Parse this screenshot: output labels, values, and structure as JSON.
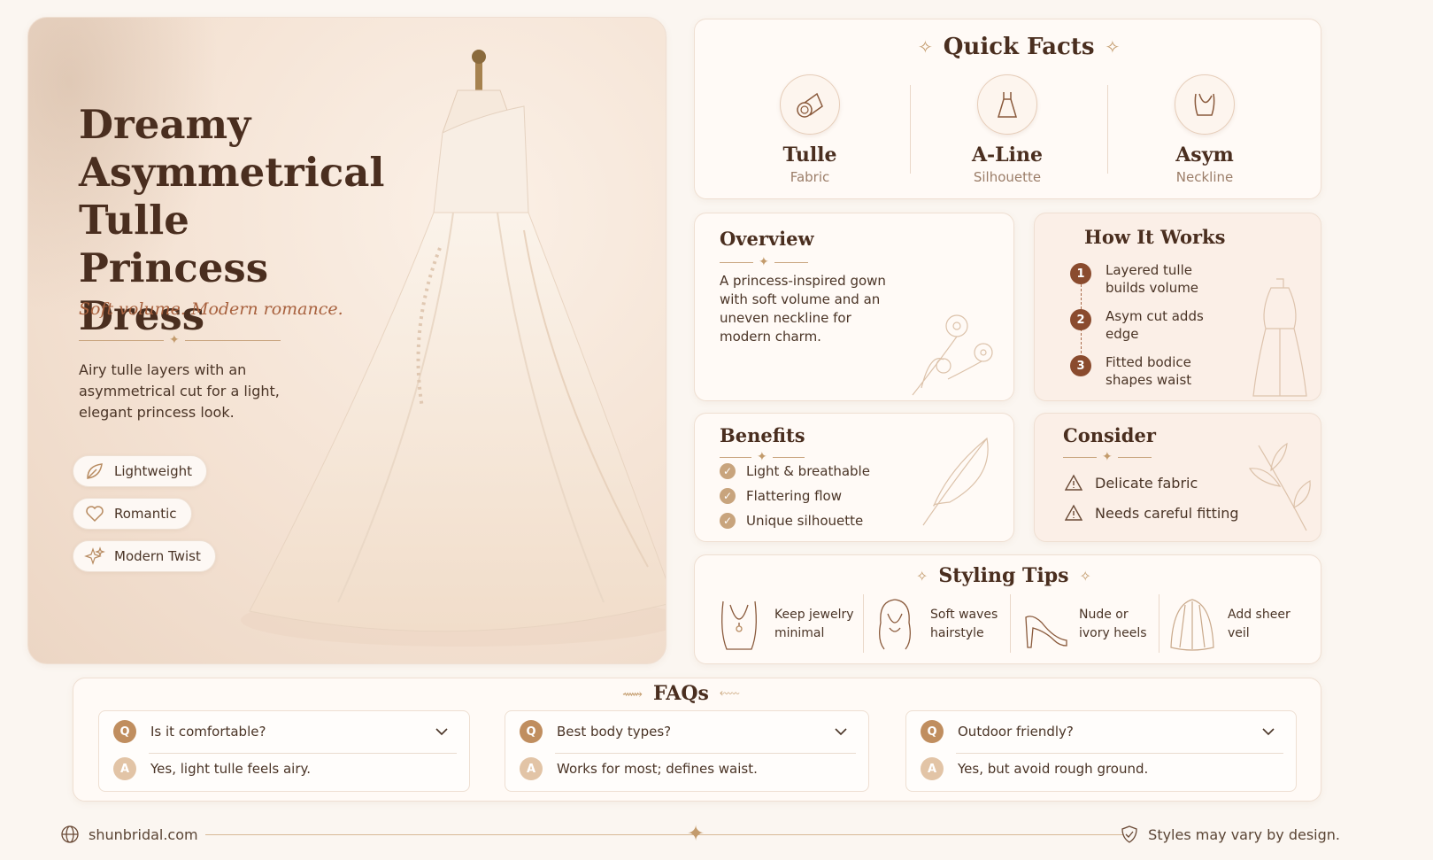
{
  "hero": {
    "title": "Dreamy Asymmetrical Tulle Princess Dress",
    "tagline": "Soft volume. Modern romance.",
    "description": "Airy tulle layers with an asymmetrical cut for a light, elegant princess look.",
    "features": [
      {
        "label": "Lightweight",
        "icon": "leaf-icon"
      },
      {
        "label": "Romantic",
        "icon": "heart-icon"
      },
      {
        "label": "Modern Twist",
        "icon": "sparkle-icon"
      }
    ]
  },
  "quick_facts": {
    "title": "Quick Facts",
    "items": [
      {
        "value": "Tulle",
        "label": "Fabric",
        "icon": "fabric-roll-icon"
      },
      {
        "value": "A-Line",
        "label": "Silhouette",
        "icon": "dress-icon"
      },
      {
        "value": "Asym",
        "label": "Neckline",
        "icon": "neckline-icon"
      }
    ]
  },
  "overview": {
    "title": "Overview",
    "text": "A princess-inspired gown with soft volume and an uneven neckline for modern charm."
  },
  "how_it_works": {
    "title": "How It Works",
    "steps": [
      {
        "num": "1",
        "text": "Layered tulle builds volume"
      },
      {
        "num": "2",
        "text": "Asym cut adds edge"
      },
      {
        "num": "3",
        "text": "Fitted bodice shapes waist"
      }
    ]
  },
  "benefits": {
    "title": "Benefits",
    "items": [
      "Light & breathable",
      "Flattering flow",
      "Unique silhouette"
    ]
  },
  "consider": {
    "title": "Consider",
    "items": [
      "Delicate fabric",
      "Needs careful fitting"
    ]
  },
  "styling": {
    "title": "Styling Tips",
    "tips": [
      {
        "text": "Keep jewelry minimal",
        "icon": "necklace-icon"
      },
      {
        "text": "Soft waves hairstyle",
        "icon": "hair-icon"
      },
      {
        "text": "Nude or ivory heels",
        "icon": "heel-icon"
      },
      {
        "text": "Add sheer veil",
        "icon": "veil-icon"
      }
    ]
  },
  "faqs": {
    "title": "FAQs",
    "items": [
      {
        "q": "Is it comfortable?",
        "a": "Yes, light tulle feels airy."
      },
      {
        "q": "Best body types?",
        "a": "Works for most; defines waist."
      },
      {
        "q": "Outdoor friendly?",
        "a": "Yes, but avoid rough ground."
      }
    ],
    "q_badge": "Q",
    "a_badge": "A"
  },
  "footer": {
    "site": "shunbridal.com",
    "note": "Styles may vary by design."
  },
  "colors": {
    "accent": "#c39b6c",
    "brown": "#8a4b2e",
    "heading": "#4a2e1f",
    "background": "#fbf6f1"
  }
}
